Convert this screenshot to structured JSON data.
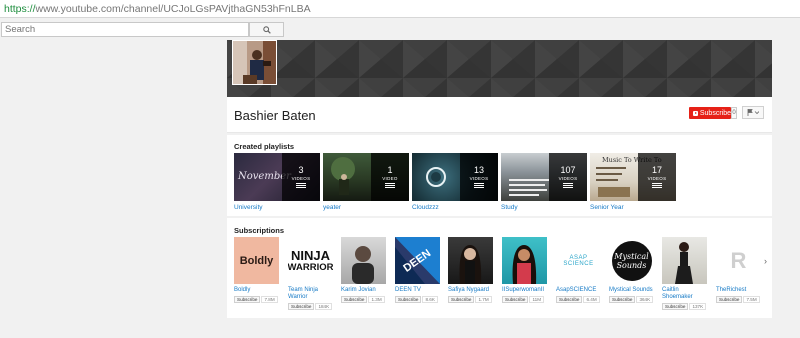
{
  "browser": {
    "url_scheme": "https://",
    "url_rest": "www.youtube.com/channel/UCJoLGsPAVjthaGN53hFnLBA"
  },
  "search": {
    "placeholder": "Search",
    "icon": "search-icon"
  },
  "channel": {
    "name": "Bashier Baten",
    "subscribe_label": "Subscribe",
    "subscriber_count": "0",
    "settings_icon": "flag-icon"
  },
  "playlists": {
    "section_title": "Created playlists",
    "items": [
      {
        "label": "University",
        "count": "3",
        "videos_label": "VIDEOS",
        "overlay_text": "November"
      },
      {
        "label": "yeater",
        "count": "1",
        "videos_label": "VIDEO",
        "overlay_text": ""
      },
      {
        "label": "Cloudzzz",
        "count": "13",
        "videos_label": "VIDEOS",
        "overlay_text": ""
      },
      {
        "label": "Study",
        "count": "107",
        "videos_label": "VIDEOS",
        "overlay_text": ""
      },
      {
        "label": "Senior Year",
        "count": "17",
        "videos_label": "VIDEOS",
        "overlay_text": "Music To Write To"
      }
    ]
  },
  "subscriptions": {
    "section_title": "Subscriptions",
    "button_label": "Subscribe",
    "items": [
      {
        "name": "Boldly",
        "name2": "",
        "count": "7.8M",
        "logo_text": "Boldly"
      },
      {
        "name": "Team Ninja",
        "name2": "Warrior",
        "count": "184K",
        "logo_text": "NINJA",
        "logo_text2": "WARRIOR"
      },
      {
        "name": "Karim Jovian",
        "name2": "",
        "count": "1.3M",
        "logo_text": ""
      },
      {
        "name": "DEEN TV",
        "name2": "",
        "count": "8.6K",
        "logo_text": "DEEN"
      },
      {
        "name": "Safiya Nygaard",
        "name2": "",
        "count": "1.7M",
        "logo_text": ""
      },
      {
        "name": "IISuperwomanII",
        "name2": "",
        "count": "11M",
        "logo_text": ""
      },
      {
        "name": "AsapSCIENCE",
        "name2": "",
        "count": "6.4M",
        "logo_text": "ASAP SCIENCE"
      },
      {
        "name": "Mystical Sounds",
        "name2": "",
        "count": "364K",
        "logo_text": "Mystical",
        "logo_text2": "Sounds"
      },
      {
        "name": "Caitlin",
        "name2": "Shoemaker",
        "count": "137K",
        "logo_text": ""
      },
      {
        "name": "TheRichest",
        "name2": "",
        "count": "7.5M",
        "logo_text": "R"
      }
    ]
  },
  "colors": {
    "subscribe_red": "#e62117",
    "link_blue": "#167ac6",
    "url_green": "#1e8e3e"
  }
}
